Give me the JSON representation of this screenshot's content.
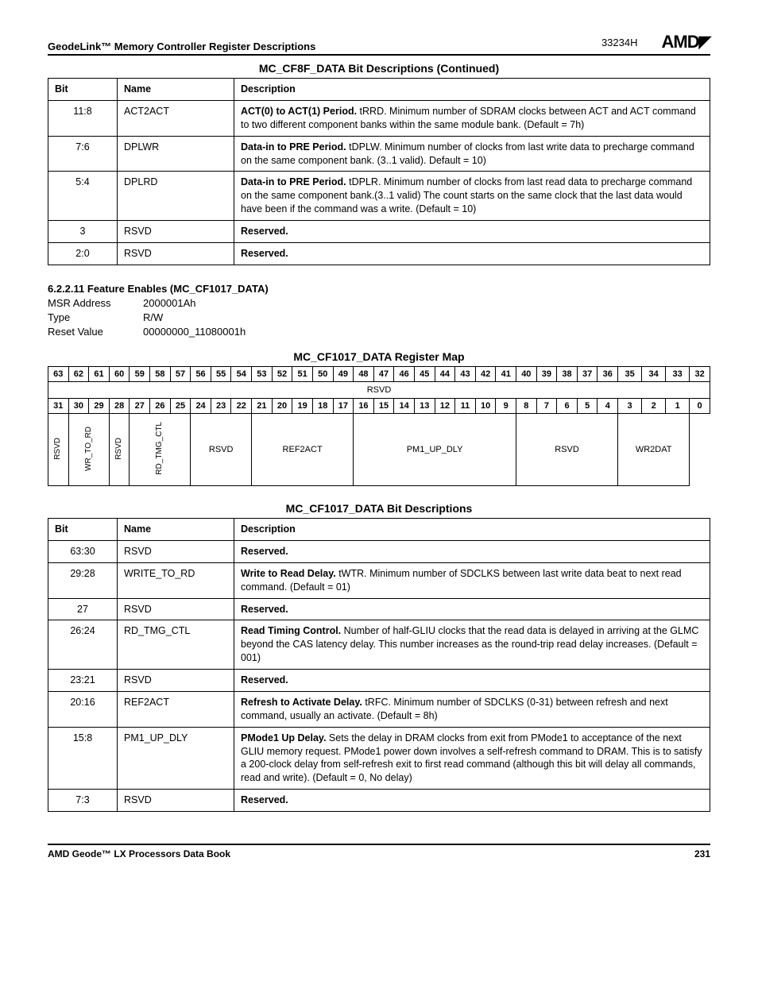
{
  "header": {
    "title": "GeodeLink™ Memory Controller Register Descriptions",
    "docnum": "33234H",
    "logo": "AMD"
  },
  "table1": {
    "title": "MC_CF8F_DATA Bit Descriptions (Continued)",
    "headers": {
      "bit": "Bit",
      "name": "Name",
      "desc": "Description"
    },
    "rows": [
      {
        "bit": "11:8",
        "name": "ACT2ACT",
        "desc_lead": "ACT(0) to ACT(1) Period.",
        "desc_rest": " tRRD. Minimum number of SDRAM clocks between ACT and ACT command to two different component banks within the same module bank. (Default = 7h)"
      },
      {
        "bit": "7:6",
        "name": "DPLWR",
        "desc_lead": "Data-in to PRE Period.",
        "desc_rest": " tDPLW. Minimum number of clocks from last write data to precharge command on the same component bank. (3..1 valid). Default = 10)"
      },
      {
        "bit": "5:4",
        "name": "DPLRD",
        "desc_lead": "Data-in to PRE Period.",
        "desc_rest": " tDPLR. Minimum number of clocks from last read data to precharge command on the same component bank.(3..1 valid) The count starts on the same clock that the last data would have been if the command was a write. (Default = 10)"
      },
      {
        "bit": "3",
        "name": "RSVD",
        "desc_lead": "Reserved.",
        "desc_rest": ""
      },
      {
        "bit": "2:0",
        "name": "RSVD",
        "desc_lead": "Reserved.",
        "desc_rest": ""
      }
    ]
  },
  "section": {
    "heading": "6.2.2.11   Feature Enables (MC_CF1017_DATA)",
    "meta": {
      "msr_k": "MSR Address",
      "msr_v": "2000001Ah",
      "type_k": "Type",
      "type_v": "R/W",
      "reset_k": "Reset Value",
      "reset_v": "00000000_11080001h"
    }
  },
  "regmap": {
    "title": "MC_CF1017_DATA Register Map",
    "row1_bits": [
      "63",
      "62",
      "61",
      "60",
      "59",
      "58",
      "57",
      "56",
      "55",
      "54",
      "53",
      "52",
      "51",
      "50",
      "49",
      "48",
      "47",
      "46",
      "45",
      "44",
      "43",
      "42",
      "41",
      "40",
      "39",
      "38",
      "37",
      "36",
      "35",
      "34",
      "33",
      "32"
    ],
    "row1_field": "RSVD",
    "row2_bits": [
      "31",
      "30",
      "29",
      "28",
      "27",
      "26",
      "25",
      "24",
      "23",
      "22",
      "21",
      "20",
      "19",
      "18",
      "17",
      "16",
      "15",
      "14",
      "13",
      "12",
      "11",
      "10",
      "9",
      "8",
      "7",
      "6",
      "5",
      "4",
      "3",
      "2",
      "1",
      "0"
    ],
    "row2_fields": {
      "f0": "RSVD",
      "f1": "WR_TO_RD",
      "f2": "RSVD",
      "f3": "RD_TMG_CTL",
      "f4": "RSVD",
      "f5": "REF2ACT",
      "f6": "PM1_UP_DLY",
      "f7": "RSVD",
      "f8": "WR2DAT"
    }
  },
  "table2": {
    "title": "MC_CF1017_DATA Bit Descriptions",
    "headers": {
      "bit": "Bit",
      "name": "Name",
      "desc": "Description"
    },
    "rows": [
      {
        "bit": "63:30",
        "name": "RSVD",
        "desc_lead": "Reserved.",
        "desc_rest": ""
      },
      {
        "bit": "29:28",
        "name": "WRITE_TO_RD",
        "desc_lead": "Write to Read Delay.",
        "desc_rest": " tWTR. Minimum number of SDCLKS between last write data beat to next read command. (Default = 01)"
      },
      {
        "bit": "27",
        "name": "RSVD",
        "desc_lead": "Reserved.",
        "desc_rest": ""
      },
      {
        "bit": "26:24",
        "name": "RD_TMG_CTL",
        "desc_lead": "Read Timing Control.",
        "desc_rest": " Number of half-GLIU clocks that the read data is delayed in arriving at the GLMC beyond the CAS latency delay. This number increases as the round-trip read delay increases. (Default = 001)"
      },
      {
        "bit": "23:21",
        "name": "RSVD",
        "desc_lead": "Reserved.",
        "desc_rest": ""
      },
      {
        "bit": "20:16",
        "name": "REF2ACT",
        "desc_lead": "Refresh to Activate Delay.",
        "desc_rest": " tRFC. Minimum number of SDCLKS (0-31) between refresh and next command, usually an activate. (Default = 8h)"
      },
      {
        "bit": "15:8",
        "name": "PM1_UP_DLY",
        "desc_lead": "PMode1 Up Delay.",
        "desc_rest": " Sets the delay in DRAM clocks from exit from PMode1 to acceptance of the next GLIU memory request. PMode1 power down involves a self-refresh command to DRAM. This is to satisfy a 200-clock delay from self-refresh exit to first read command (although this bit will delay all commands, read and write). (Default = 0, No delay)"
      },
      {
        "bit": "7:3",
        "name": "RSVD",
        "desc_lead": "Reserved.",
        "desc_rest": ""
      }
    ]
  },
  "footer": {
    "left": "AMD Geode™ LX Processors Data Book",
    "right": "231"
  }
}
